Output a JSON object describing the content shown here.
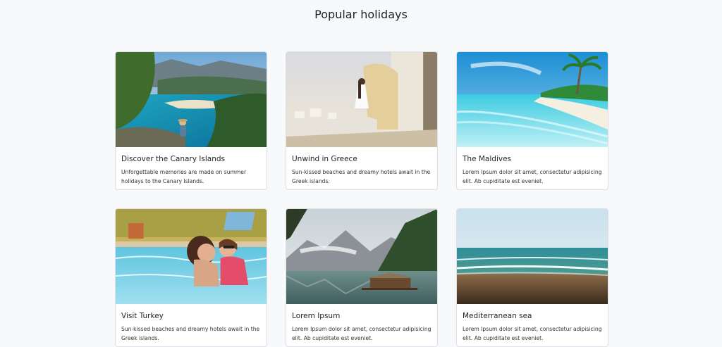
{
  "page": {
    "title": "Popular holidays"
  },
  "cards": [
    {
      "title": "Discover the Canary Islands",
      "text": "Unforgettable memories are made on summer holidays to the Canary Islands.",
      "image": "lagoon-coast-photo"
    },
    {
      "title": "Unwind in Greece",
      "text": "Sun-kissed beaches and dreamy hotels await in the Greek islands.",
      "image": "santorini-photo"
    },
    {
      "title": "The Maldives",
      "text": "Lorem Ipsum dolor sit amet, consectetur adipisicing elit. Ab cupiditate est eveniet.",
      "image": "tropical-beach-photo"
    },
    {
      "title": "Visit Turkey",
      "text": "Sun-kissed beaches and dreamy hotels await in the Greek islands.",
      "image": "pool-family-photo"
    },
    {
      "title": "Lorem Ipsum",
      "text": "Lorem Ipsum dolor sit amet, consectetur adipisicing elit. Ab cupiditate est eveniet.",
      "image": "mountain-lake-photo"
    },
    {
      "title": "Mediterranean sea",
      "text": "Lorem Ipsum dolor sit amet, consectetur adipisicing elit. Ab cupiditate est eveniet.",
      "image": "sea-shore-photo"
    }
  ]
}
